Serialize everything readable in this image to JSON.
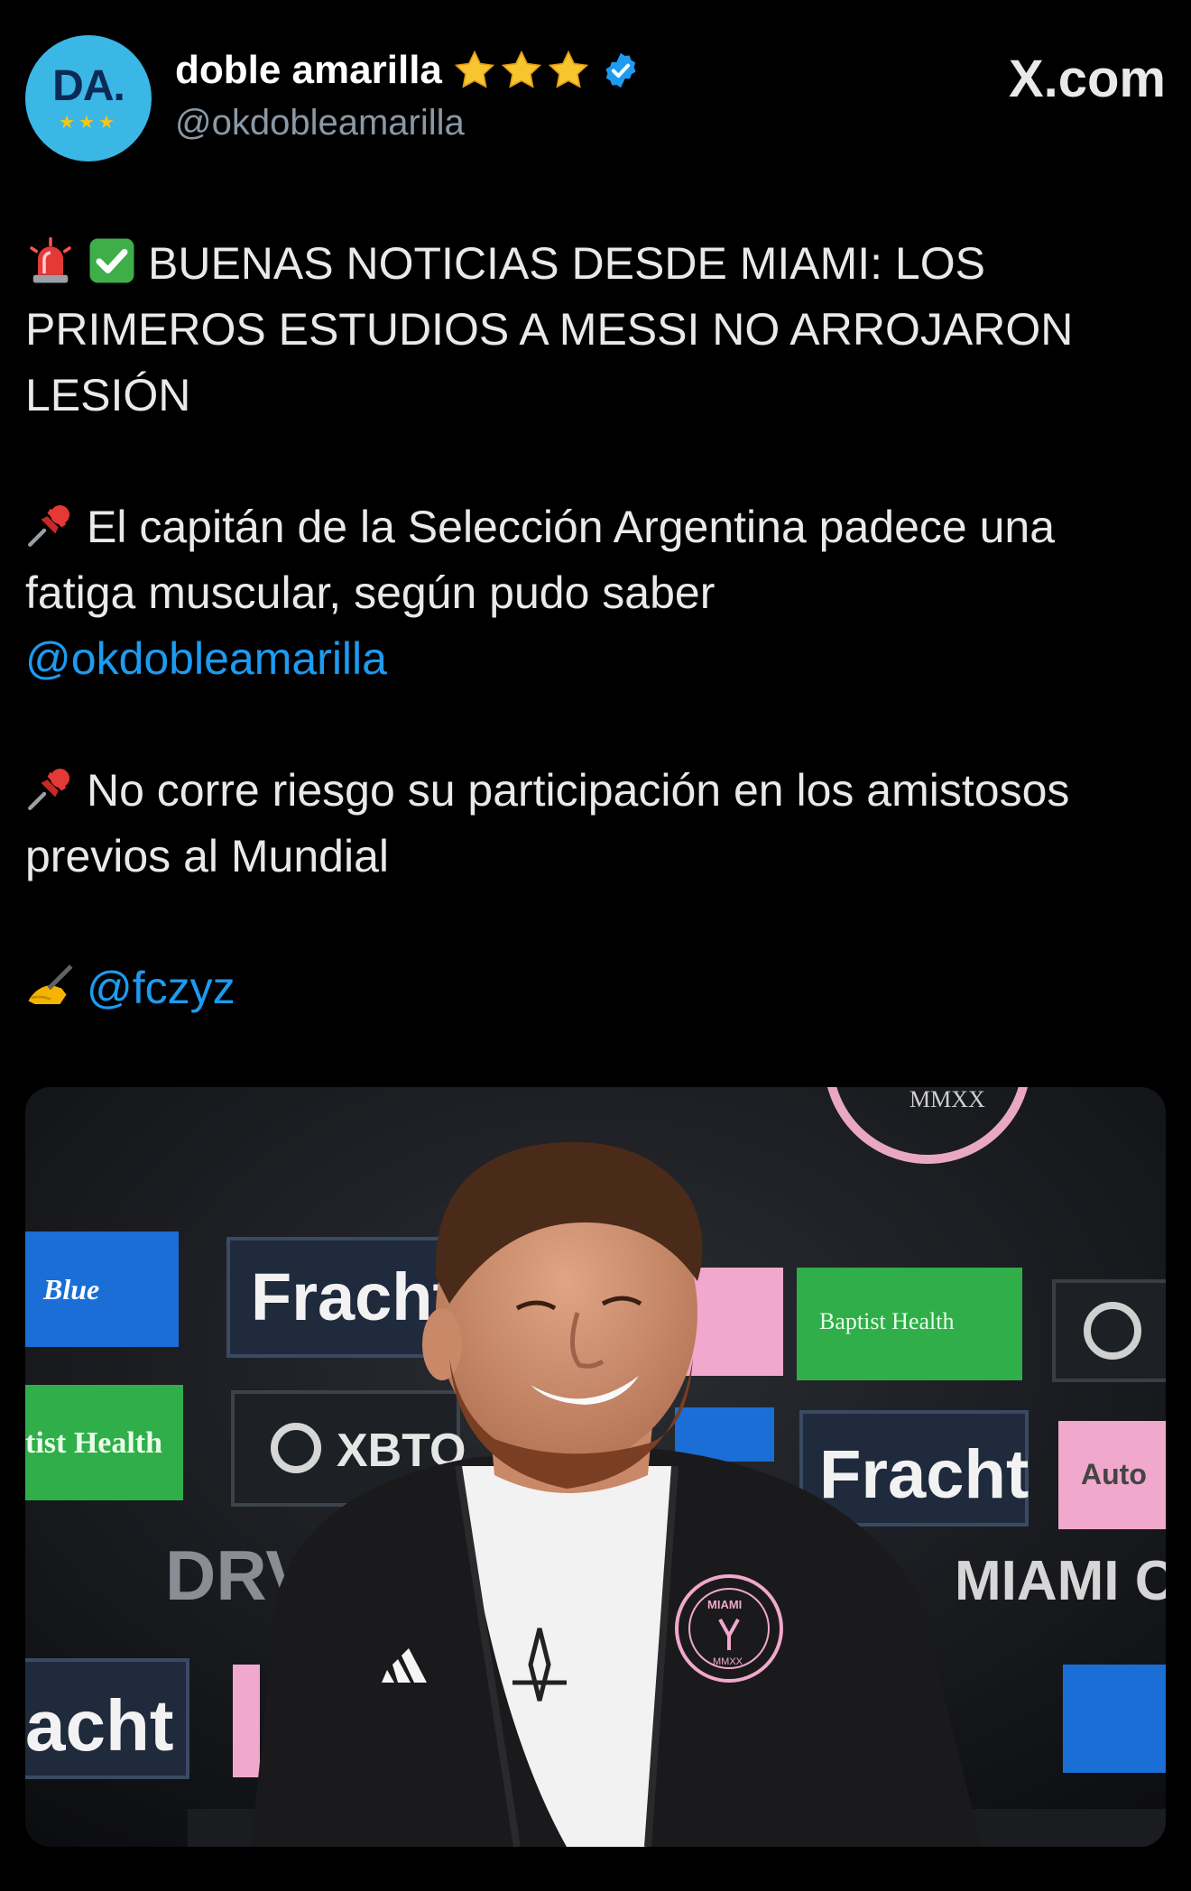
{
  "source_badge": "X.com",
  "author": {
    "avatar_text": "DA.",
    "avatar_stars": "★★★",
    "display_name": "doble amarilla",
    "handle": "@okdobleamarilla",
    "verified": true,
    "name_stars_count": 3,
    "avatar_color": "#3bb7e6"
  },
  "tweet": {
    "line1_emoji": [
      "police-light-icon",
      "check-mark-icon"
    ],
    "headline": "BUENAS NOTICIAS DESDE MIAMI: LOS PRIMEROS ESTUDIOS A MESSI NO ARROJARON LESIÓN",
    "para2_text": "El capitán de la Selección Argentina padece una fatiga muscular, según pudo saber",
    "para2_mention": "@okdobleamarilla",
    "para3_text": "No corre riesgo su participación en los amistosos previos al Mundial",
    "para4_mention": "@fczyz",
    "mention_color": "#1d9bf0"
  },
  "media": {
    "sponsor_boards": [
      "Blue",
      "Fracht",
      "Baptist Health",
      "tist Health",
      "XBTO",
      "Fracht",
      "Auto",
      "DRV PNK",
      "MIAMI CF",
      "acht"
    ],
    "crest_text": "MIAMI",
    "crest_year": "MMXX",
    "top_crest_text": "MMXX"
  }
}
